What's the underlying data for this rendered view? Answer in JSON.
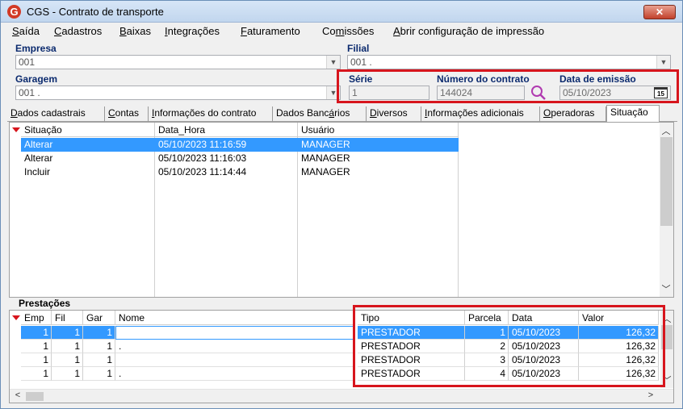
{
  "window": {
    "title": "CGS - Contrato de transporte",
    "close_symbol": "✕"
  },
  "menu": [
    {
      "u": "S",
      "rest": "aída"
    },
    {
      "u": "C",
      "rest": "adastros"
    },
    {
      "u": "B",
      "rest": "aixas"
    },
    {
      "u": "I",
      "rest": "ntegrações"
    },
    {
      "u": "F",
      "rest": "aturamento"
    },
    {
      "pre": "Co",
      "u": "m",
      "rest": "issões"
    },
    {
      "u": "A",
      "rest": "brir configuração de impressão"
    }
  ],
  "form": {
    "empresa_label": "Empresa",
    "empresa_value": "001",
    "filial_label": "Filial",
    "filial_value": "001 .",
    "garagem_label": "Garagem",
    "garagem_value": "001 .",
    "serie_label": "Série",
    "serie_value": "1",
    "numero_label": "Número do contrato",
    "numero_value": "144024",
    "data_label": "Data de emissão",
    "data_value": "05/10/2023",
    "calendar_day": "15"
  },
  "tabs": [
    {
      "pre": "",
      "u": "D",
      "rest": "ados cadastrais"
    },
    {
      "pre": "",
      "u": "C",
      "rest": "ontas"
    },
    {
      "pre": "",
      "u": "I",
      "rest": "nformações do contrato"
    },
    {
      "pre": "Dados Banc",
      "u": "á",
      "rest": "rios"
    },
    {
      "pre": "",
      "u": "D",
      "rest": "iversos"
    },
    {
      "pre": "",
      "u": "I",
      "rest": "nformações adicionais"
    },
    {
      "pre": "",
      "u": "O",
      "rest": "peradoras"
    },
    {
      "pre": "Situação",
      "u": "",
      "rest": ""
    }
  ],
  "situacao_table": {
    "headers": [
      "Situação",
      "Data_Hora",
      "Usuário"
    ],
    "rows": [
      [
        "Alterar",
        "05/10/2023 11:16:59",
        "MANAGER"
      ],
      [
        "Alterar",
        "05/10/2023 11:16:03",
        "MANAGER"
      ],
      [
        "Incluir",
        "05/10/2023 11:14:44",
        "MANAGER"
      ]
    ]
  },
  "prestacoes": {
    "label": "Prestações",
    "headers": [
      "Emp",
      "Fil",
      "Gar",
      "Nome",
      "Tipo",
      "Parcela",
      "Data",
      "Valor"
    ],
    "rows": [
      [
        "1",
        "1",
        "1",
        "",
        "PRESTADOR",
        "1",
        "05/10/2023",
        "126,32"
      ],
      [
        "1",
        "1",
        "1",
        ".",
        "PRESTADOR",
        "2",
        "05/10/2023",
        "126,32"
      ],
      [
        "1",
        "1",
        "1",
        "",
        "PRESTADOR",
        "3",
        "05/10/2023",
        "126,32"
      ],
      [
        "1",
        "1",
        "1",
        ".",
        "PRESTADOR",
        "4",
        "05/10/2023",
        "126,32"
      ]
    ]
  },
  "colors": {
    "highlight_box": "#d7151d",
    "selection": "#3399ff",
    "label_blue": "#0b2a6e"
  }
}
